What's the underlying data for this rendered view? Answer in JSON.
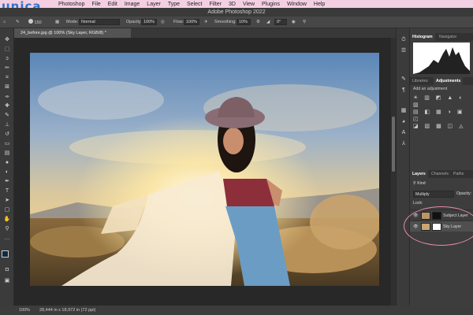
{
  "menubar": {
    "watermark": "unica",
    "items": [
      "Photoshop",
      "File",
      "Edit",
      "Image",
      "Layer",
      "Type",
      "Select",
      "Filter",
      "3D",
      "View",
      "Plugins",
      "Window",
      "Help"
    ]
  },
  "titlebar": {
    "title": "Adobe Photoshop 2022"
  },
  "options": {
    "brush_size": "150",
    "mode_label": "Mode:",
    "mode_value": "Normal",
    "opacity_label": "Opacity:",
    "opacity_value": "100%",
    "flow_label": "Flow:",
    "flow_value": "100%",
    "smoothing_label": "Smoothing:",
    "smoothing_value": "10%",
    "angle_value": "0°"
  },
  "document": {
    "tab_label": "24_before.jpg @ 100% (Sky Layer, RGB/8) *"
  },
  "status": {
    "zoom": "100%",
    "doc_size": "28,444 in x 18,972 in (72 ppi)"
  },
  "panels": {
    "histogram_tabs": [
      "Histogram",
      "Navigator"
    ],
    "adjust_tabs": [
      "Libraries",
      "Adjustments"
    ],
    "adjust_hint": "Add an adjustment",
    "layer_tabs": [
      "Layers",
      "Channels",
      "Paths"
    ],
    "kind_label": "Kind",
    "blend_mode": "Multiply",
    "opacity_label": "Opacity:",
    "lock_label": "Lock:",
    "layers": [
      {
        "name": "Subject Layer"
      },
      {
        "name": "Sky Layer"
      }
    ]
  },
  "colors": {
    "accent_annotation": "#e58aa9",
    "menubar_bg": "#f4cfe3",
    "watermark": "#2d74c9"
  },
  "icons": [
    "move-icon",
    "marquee-icon",
    "lasso-icon",
    "quick-select-icon",
    "crop-icon",
    "frame-icon",
    "eyedropper-icon",
    "healing-icon",
    "brush-icon",
    "clone-stamp-icon",
    "history-brush-icon",
    "eraser-icon",
    "gradient-icon",
    "blur-icon",
    "dodge-icon",
    "pen-icon",
    "type-icon",
    "path-select-icon",
    "rectangle-icon",
    "hand-icon",
    "zoom-icon",
    "more-tools-icon"
  ]
}
